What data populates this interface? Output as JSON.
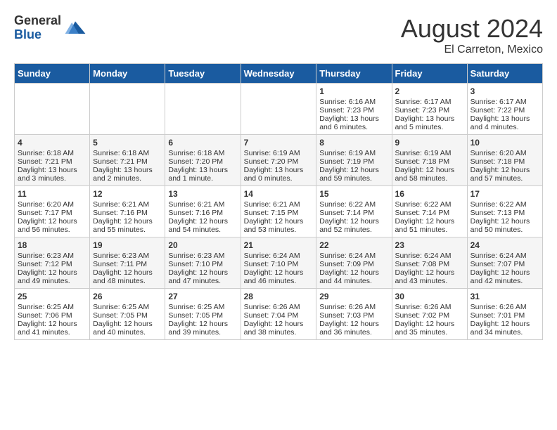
{
  "logo": {
    "general": "General",
    "blue": "Blue"
  },
  "header": {
    "month": "August 2024",
    "location": "El Carreton, Mexico"
  },
  "weekdays": [
    "Sunday",
    "Monday",
    "Tuesday",
    "Wednesday",
    "Thursday",
    "Friday",
    "Saturday"
  ],
  "weeks": [
    [
      {
        "day": "",
        "content": ""
      },
      {
        "day": "",
        "content": ""
      },
      {
        "day": "",
        "content": ""
      },
      {
        "day": "",
        "content": ""
      },
      {
        "day": "1",
        "content": "Sunrise: 6:16 AM\nSunset: 7:23 PM\nDaylight: 13 hours and 6 minutes."
      },
      {
        "day": "2",
        "content": "Sunrise: 6:17 AM\nSunset: 7:23 PM\nDaylight: 13 hours and 5 minutes."
      },
      {
        "day": "3",
        "content": "Sunrise: 6:17 AM\nSunset: 7:22 PM\nDaylight: 13 hours and 4 minutes."
      }
    ],
    [
      {
        "day": "4",
        "content": "Sunrise: 6:18 AM\nSunset: 7:21 PM\nDaylight: 13 hours and 3 minutes."
      },
      {
        "day": "5",
        "content": "Sunrise: 6:18 AM\nSunset: 7:21 PM\nDaylight: 13 hours and 2 minutes."
      },
      {
        "day": "6",
        "content": "Sunrise: 6:18 AM\nSunset: 7:20 PM\nDaylight: 13 hours and 1 minute."
      },
      {
        "day": "7",
        "content": "Sunrise: 6:19 AM\nSunset: 7:20 PM\nDaylight: 13 hours and 0 minutes."
      },
      {
        "day": "8",
        "content": "Sunrise: 6:19 AM\nSunset: 7:19 PM\nDaylight: 12 hours and 59 minutes."
      },
      {
        "day": "9",
        "content": "Sunrise: 6:19 AM\nSunset: 7:18 PM\nDaylight: 12 hours and 58 minutes."
      },
      {
        "day": "10",
        "content": "Sunrise: 6:20 AM\nSunset: 7:18 PM\nDaylight: 12 hours and 57 minutes."
      }
    ],
    [
      {
        "day": "11",
        "content": "Sunrise: 6:20 AM\nSunset: 7:17 PM\nDaylight: 12 hours and 56 minutes."
      },
      {
        "day": "12",
        "content": "Sunrise: 6:21 AM\nSunset: 7:16 PM\nDaylight: 12 hours and 55 minutes."
      },
      {
        "day": "13",
        "content": "Sunrise: 6:21 AM\nSunset: 7:16 PM\nDaylight: 12 hours and 54 minutes."
      },
      {
        "day": "14",
        "content": "Sunrise: 6:21 AM\nSunset: 7:15 PM\nDaylight: 12 hours and 53 minutes."
      },
      {
        "day": "15",
        "content": "Sunrise: 6:22 AM\nSunset: 7:14 PM\nDaylight: 12 hours and 52 minutes."
      },
      {
        "day": "16",
        "content": "Sunrise: 6:22 AM\nSunset: 7:14 PM\nDaylight: 12 hours and 51 minutes."
      },
      {
        "day": "17",
        "content": "Sunrise: 6:22 AM\nSunset: 7:13 PM\nDaylight: 12 hours and 50 minutes."
      }
    ],
    [
      {
        "day": "18",
        "content": "Sunrise: 6:23 AM\nSunset: 7:12 PM\nDaylight: 12 hours and 49 minutes."
      },
      {
        "day": "19",
        "content": "Sunrise: 6:23 AM\nSunset: 7:11 PM\nDaylight: 12 hours and 48 minutes."
      },
      {
        "day": "20",
        "content": "Sunrise: 6:23 AM\nSunset: 7:10 PM\nDaylight: 12 hours and 47 minutes."
      },
      {
        "day": "21",
        "content": "Sunrise: 6:24 AM\nSunset: 7:10 PM\nDaylight: 12 hours and 46 minutes."
      },
      {
        "day": "22",
        "content": "Sunrise: 6:24 AM\nSunset: 7:09 PM\nDaylight: 12 hours and 44 minutes."
      },
      {
        "day": "23",
        "content": "Sunrise: 6:24 AM\nSunset: 7:08 PM\nDaylight: 12 hours and 43 minutes."
      },
      {
        "day": "24",
        "content": "Sunrise: 6:24 AM\nSunset: 7:07 PM\nDaylight: 12 hours and 42 minutes."
      }
    ],
    [
      {
        "day": "25",
        "content": "Sunrise: 6:25 AM\nSunset: 7:06 PM\nDaylight: 12 hours and 41 minutes."
      },
      {
        "day": "26",
        "content": "Sunrise: 6:25 AM\nSunset: 7:05 PM\nDaylight: 12 hours and 40 minutes."
      },
      {
        "day": "27",
        "content": "Sunrise: 6:25 AM\nSunset: 7:05 PM\nDaylight: 12 hours and 39 minutes."
      },
      {
        "day": "28",
        "content": "Sunrise: 6:26 AM\nSunset: 7:04 PM\nDaylight: 12 hours and 38 minutes."
      },
      {
        "day": "29",
        "content": "Sunrise: 6:26 AM\nSunset: 7:03 PM\nDaylight: 12 hours and 36 minutes."
      },
      {
        "day": "30",
        "content": "Sunrise: 6:26 AM\nSunset: 7:02 PM\nDaylight: 12 hours and 35 minutes."
      },
      {
        "day": "31",
        "content": "Sunrise: 6:26 AM\nSunset: 7:01 PM\nDaylight: 12 hours and 34 minutes."
      }
    ]
  ]
}
